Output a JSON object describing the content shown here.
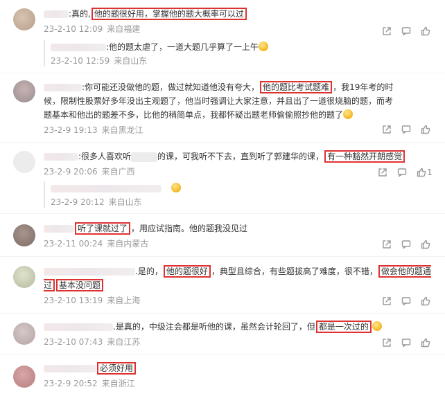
{
  "comments": [
    {
      "parts": [
        ":真的,",
        "他的题很好用，掌握他的题大概率可以过"
      ],
      "date": "23-2-10 12:09",
      "loc": "来自福建",
      "avatar_color": "#c9b7a5",
      "reply": {
        "text": ":他的题太虐了，一道大题几乎算了一上午",
        "date": "23-2-10 12:59",
        "loc": "来自山东"
      }
    },
    {
      "parts": [
        ":你可能还没做他的题，做过就知道他没有夸大，",
        "他的题比考试题难",
        "，我19年考的时候，限制性股票好多年没出主观题了，他当时强调让大家注意，并且出了一道很烧脑的题，而考题基本和他出的题差不多，比他的稍简单点，我都怀疑出题老师偷偷照抄他的题了"
      ],
      "date": "23-2-9 19:13",
      "loc": "来自黑龙江",
      "avatar_color": "#b3a6a7"
    },
    {
      "parts": [
        ":很多人喜欢听",
        "的课，可我听不下去，直到听了郭建华的课，",
        "有一种豁然开朗感觉"
      ],
      "date": "23-2-9 20:06",
      "loc": "来自广西",
      "avatar_color": "#ececec",
      "like_count": "1",
      "reply": {
        "text": "",
        "date": "23-2-9 20:12",
        "loc": "来自山东"
      }
    },
    {
      "parts": [
        "听了课就过了",
        "，用应试指南。他的题我没见过"
      ],
      "date": "23-2-11 00:24",
      "loc": "来自内蒙古",
      "avatar_color": "#9c8a83"
    },
    {
      "parts": [
        ".是的，",
        "他的题很好",
        "，典型且综合，有些题拔高了难度，很不错，",
        "做会他的题通过",
        "基本没问题"
      ],
      "date": "23-2-10 13:19",
      "loc": "来自上海",
      "avatar_color": "#c6ccb4"
    },
    {
      "parts": [
        ".是真的，中级注会都是听他的课，虽然会计轮回了，但",
        "都是一次过的"
      ],
      "date": "23-2-10 07:43",
      "loc": "来自江苏",
      "avatar_color": "#c7b5b5"
    },
    {
      "parts": [
        "必须好用"
      ],
      "date": "23-2-9 20:52",
      "loc": "来自浙江",
      "avatar_color": "#c98f90"
    }
  ]
}
